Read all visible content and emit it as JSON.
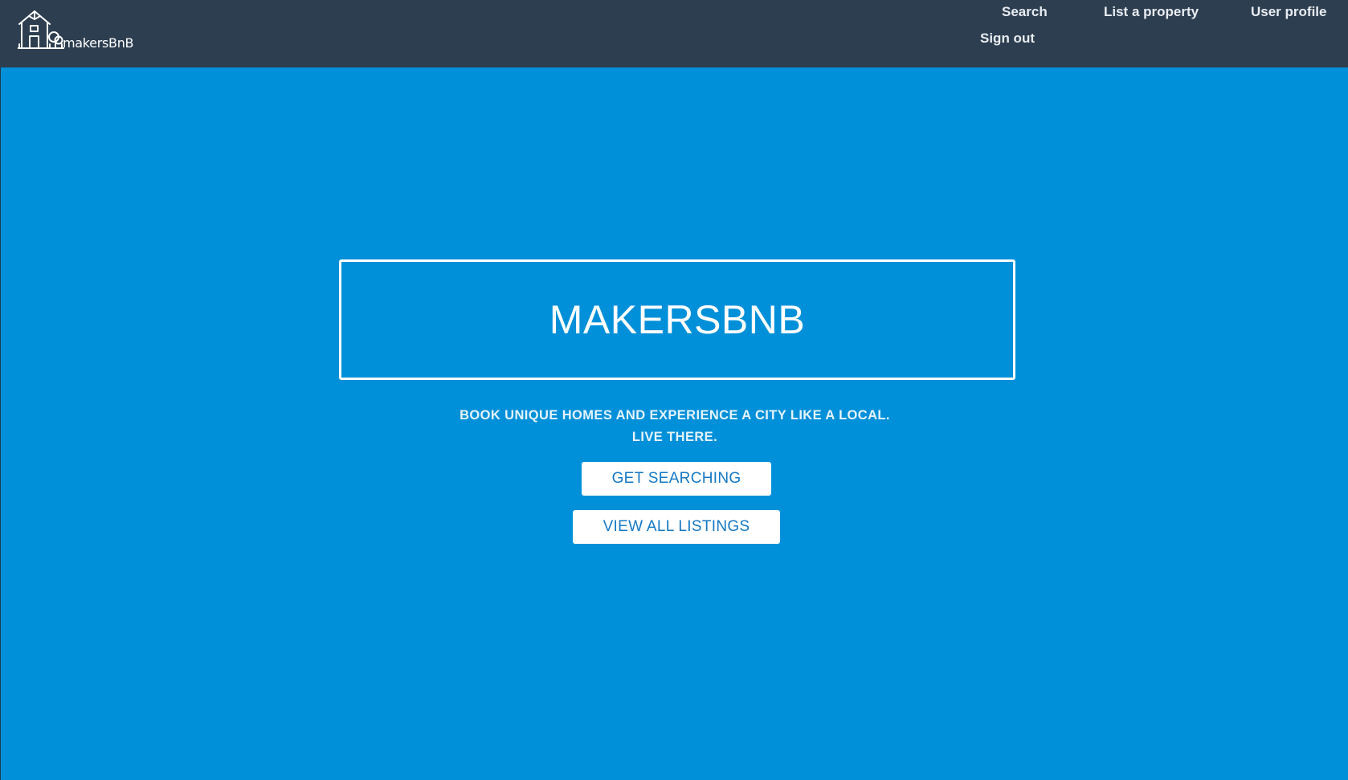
{
  "brand": {
    "name": "makersBnB",
    "logo_icon": "house-with-tree-icon"
  },
  "nav": {
    "search": "Search",
    "list_property": "List a property",
    "user_profile": "User profile",
    "sign_out": "Sign out"
  },
  "hero": {
    "title": "MAKERSBNB",
    "tagline_line1": "BOOK UNIQUE HOMES AND EXPERIENCE A CITY LIKE A LOCAL.",
    "tagline_line2": "LIVE THERE.",
    "primary_button": "GET SEARCHING",
    "secondary_button": "VIEW ALL LISTINGS"
  },
  "colors": {
    "navbar": "#2d3e50",
    "hero_background": "#0090d9",
    "button_text": "#1478c4",
    "text_light": "#ffffff"
  }
}
